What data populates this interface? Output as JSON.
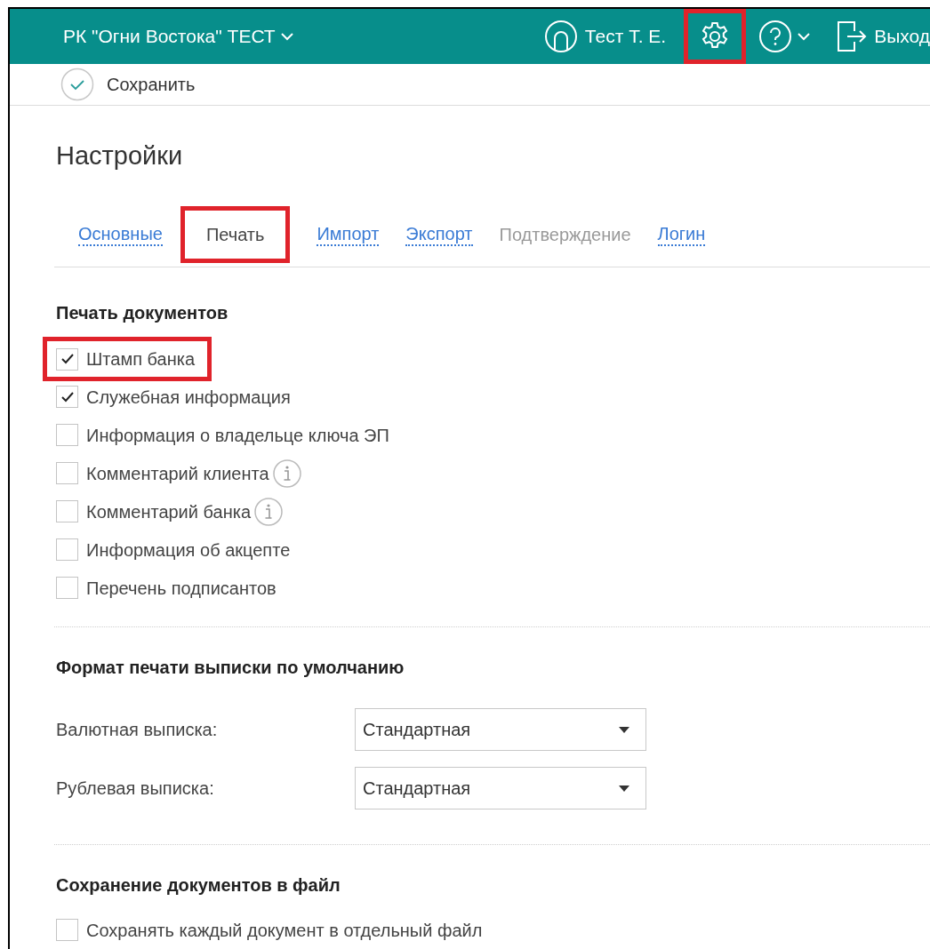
{
  "header": {
    "organization": "РК \"Огни Востока\" ТЕСТ",
    "user": "Тест Т. Е.",
    "settings_highlighted": true,
    "logout": "Выход"
  },
  "toolbar": {
    "save": "Сохранить"
  },
  "title": "Настройки",
  "tabs": [
    {
      "label": "Основные",
      "selected": false,
      "disabled": false,
      "highlighted": false
    },
    {
      "label": "Печать",
      "selected": true,
      "disabled": false,
      "highlighted": true
    },
    {
      "label": "Импорт",
      "selected": false,
      "disabled": false,
      "highlighted": false
    },
    {
      "label": "Экспорт",
      "selected": false,
      "disabled": false,
      "highlighted": false
    },
    {
      "label": "Подтверждение",
      "selected": false,
      "disabled": true,
      "highlighted": false
    },
    {
      "label": "Логин",
      "selected": false,
      "disabled": false,
      "highlighted": false
    }
  ],
  "print_section": {
    "title": "Печать документов",
    "options": [
      {
        "label": "Штамп банка",
        "checked": true,
        "highlighted": true,
        "info": false
      },
      {
        "label": "Служебная информация",
        "checked": true,
        "highlighted": false,
        "info": false
      },
      {
        "label": "Информация о владельце ключа ЭП",
        "checked": false,
        "highlighted": false,
        "info": false
      },
      {
        "label": "Комментарий клиента",
        "checked": false,
        "highlighted": false,
        "info": true
      },
      {
        "label": "Комментарий банка",
        "checked": false,
        "highlighted": false,
        "info": true
      },
      {
        "label": "Информация об акцепте",
        "checked": false,
        "highlighted": false,
        "info": false
      },
      {
        "label": "Перечень подписантов",
        "checked": false,
        "highlighted": false,
        "info": false
      }
    ]
  },
  "format_section": {
    "title": "Формат печати выписки по умолчанию",
    "fields": [
      {
        "label": "Валютная выписка:",
        "value": "Стандартная"
      },
      {
        "label": "Рублевая выписка:",
        "value": "Стандартная"
      }
    ]
  },
  "file_section": {
    "title": "Сохранение документов в файл",
    "options": [
      {
        "label": "Сохранять каждый документ в отдельный файл",
        "checked": false,
        "highlighted": false,
        "info": false
      }
    ]
  }
}
